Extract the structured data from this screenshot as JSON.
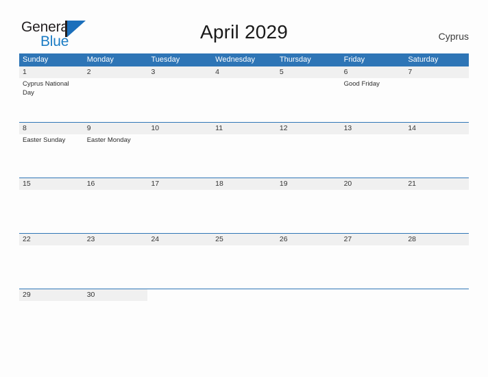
{
  "brand": {
    "word_one": "General",
    "word_two": "Blue",
    "mark_icon": "general-blue-triangle-logo",
    "color_black": "#231f20",
    "color_blue": "#1b7cc4"
  },
  "header": {
    "title": "April 2029",
    "locale": "Cyprus"
  },
  "calendar": {
    "accent_color": "#2e75b6",
    "band_color": "#f0f0f0",
    "weekdays": [
      "Sunday",
      "Monday",
      "Tuesday",
      "Wednesday",
      "Thursday",
      "Friday",
      "Saturday"
    ],
    "weeks": [
      [
        {
          "day": "1",
          "events": [
            "Cyprus National Day"
          ]
        },
        {
          "day": "2",
          "events": []
        },
        {
          "day": "3",
          "events": []
        },
        {
          "day": "4",
          "events": []
        },
        {
          "day": "5",
          "events": []
        },
        {
          "day": "6",
          "events": [
            "Good Friday"
          ]
        },
        {
          "day": "7",
          "events": []
        }
      ],
      [
        {
          "day": "8",
          "events": [
            "Easter Sunday"
          ]
        },
        {
          "day": "9",
          "events": [
            "Easter Monday"
          ]
        },
        {
          "day": "10",
          "events": []
        },
        {
          "day": "11",
          "events": []
        },
        {
          "day": "12",
          "events": []
        },
        {
          "day": "13",
          "events": []
        },
        {
          "day": "14",
          "events": []
        }
      ],
      [
        {
          "day": "15",
          "events": []
        },
        {
          "day": "16",
          "events": []
        },
        {
          "day": "17",
          "events": []
        },
        {
          "day": "18",
          "events": []
        },
        {
          "day": "19",
          "events": []
        },
        {
          "day": "20",
          "events": []
        },
        {
          "day": "21",
          "events": []
        }
      ],
      [
        {
          "day": "22",
          "events": []
        },
        {
          "day": "23",
          "events": []
        },
        {
          "day": "24",
          "events": []
        },
        {
          "day": "25",
          "events": []
        },
        {
          "day": "26",
          "events": []
        },
        {
          "day": "27",
          "events": []
        },
        {
          "day": "28",
          "events": []
        }
      ],
      [
        {
          "day": "29",
          "events": []
        },
        {
          "day": "30",
          "events": []
        },
        {
          "day": "",
          "events": []
        },
        {
          "day": "",
          "events": []
        },
        {
          "day": "",
          "events": []
        },
        {
          "day": "",
          "events": []
        },
        {
          "day": "",
          "events": []
        }
      ]
    ]
  }
}
